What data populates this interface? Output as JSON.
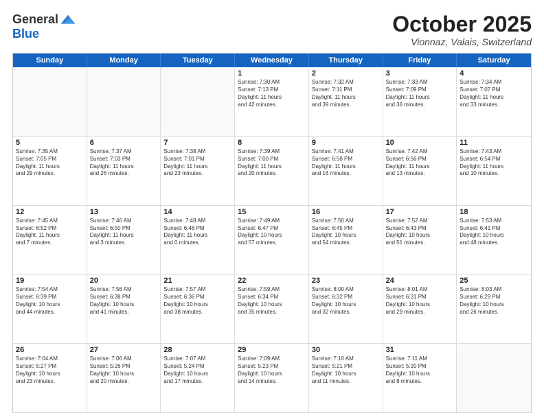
{
  "header": {
    "logo_general": "General",
    "logo_blue": "Blue",
    "month_title": "October 2025",
    "location": "Vionnaz, Valais, Switzerland"
  },
  "days_of_week": [
    "Sunday",
    "Monday",
    "Tuesday",
    "Wednesday",
    "Thursday",
    "Friday",
    "Saturday"
  ],
  "weeks": [
    [
      {
        "day": "",
        "info": "",
        "empty": true
      },
      {
        "day": "",
        "info": "",
        "empty": true
      },
      {
        "day": "",
        "info": "",
        "empty": true
      },
      {
        "day": "1",
        "info": "Sunrise: 7:30 AM\nSunset: 7:13 PM\nDaylight: 11 hours\nand 42 minutes."
      },
      {
        "day": "2",
        "info": "Sunrise: 7:32 AM\nSunset: 7:11 PM\nDaylight: 11 hours\nand 39 minutes."
      },
      {
        "day": "3",
        "info": "Sunrise: 7:33 AM\nSunset: 7:09 PM\nDaylight: 11 hours\nand 36 minutes."
      },
      {
        "day": "4",
        "info": "Sunrise: 7:34 AM\nSunset: 7:07 PM\nDaylight: 11 hours\nand 33 minutes."
      }
    ],
    [
      {
        "day": "5",
        "info": "Sunrise: 7:35 AM\nSunset: 7:05 PM\nDaylight: 11 hours\nand 29 minutes."
      },
      {
        "day": "6",
        "info": "Sunrise: 7:37 AM\nSunset: 7:03 PM\nDaylight: 11 hours\nand 26 minutes."
      },
      {
        "day": "7",
        "info": "Sunrise: 7:38 AM\nSunset: 7:01 PM\nDaylight: 11 hours\nand 23 minutes."
      },
      {
        "day": "8",
        "info": "Sunrise: 7:39 AM\nSunset: 7:00 PM\nDaylight: 11 hours\nand 20 minutes."
      },
      {
        "day": "9",
        "info": "Sunrise: 7:41 AM\nSunset: 6:58 PM\nDaylight: 11 hours\nand 16 minutes."
      },
      {
        "day": "10",
        "info": "Sunrise: 7:42 AM\nSunset: 6:56 PM\nDaylight: 11 hours\nand 13 minutes."
      },
      {
        "day": "11",
        "info": "Sunrise: 7:43 AM\nSunset: 6:54 PM\nDaylight: 11 hours\nand 10 minutes."
      }
    ],
    [
      {
        "day": "12",
        "info": "Sunrise: 7:45 AM\nSunset: 6:52 PM\nDaylight: 11 hours\nand 7 minutes."
      },
      {
        "day": "13",
        "info": "Sunrise: 7:46 AM\nSunset: 6:50 PM\nDaylight: 11 hours\nand 3 minutes."
      },
      {
        "day": "14",
        "info": "Sunrise: 7:48 AM\nSunset: 6:48 PM\nDaylight: 11 hours\nand 0 minutes."
      },
      {
        "day": "15",
        "info": "Sunrise: 7:49 AM\nSunset: 6:47 PM\nDaylight: 10 hours\nand 57 minutes."
      },
      {
        "day": "16",
        "info": "Sunrise: 7:50 AM\nSunset: 6:45 PM\nDaylight: 10 hours\nand 54 minutes."
      },
      {
        "day": "17",
        "info": "Sunrise: 7:52 AM\nSunset: 6:43 PM\nDaylight: 10 hours\nand 51 minutes."
      },
      {
        "day": "18",
        "info": "Sunrise: 7:53 AM\nSunset: 6:41 PM\nDaylight: 10 hours\nand 48 minutes."
      }
    ],
    [
      {
        "day": "19",
        "info": "Sunrise: 7:54 AM\nSunset: 6:39 PM\nDaylight: 10 hours\nand 44 minutes."
      },
      {
        "day": "20",
        "info": "Sunrise: 7:56 AM\nSunset: 6:38 PM\nDaylight: 10 hours\nand 41 minutes."
      },
      {
        "day": "21",
        "info": "Sunrise: 7:57 AM\nSunset: 6:36 PM\nDaylight: 10 hours\nand 38 minutes."
      },
      {
        "day": "22",
        "info": "Sunrise: 7:59 AM\nSunset: 6:34 PM\nDaylight: 10 hours\nand 35 minutes."
      },
      {
        "day": "23",
        "info": "Sunrise: 8:00 AM\nSunset: 6:32 PM\nDaylight: 10 hours\nand 32 minutes."
      },
      {
        "day": "24",
        "info": "Sunrise: 8:01 AM\nSunset: 6:31 PM\nDaylight: 10 hours\nand 29 minutes."
      },
      {
        "day": "25",
        "info": "Sunrise: 8:03 AM\nSunset: 6:29 PM\nDaylight: 10 hours\nand 26 minutes."
      }
    ],
    [
      {
        "day": "26",
        "info": "Sunrise: 7:04 AM\nSunset: 5:27 PM\nDaylight: 10 hours\nand 23 minutes."
      },
      {
        "day": "27",
        "info": "Sunrise: 7:06 AM\nSunset: 5:26 PM\nDaylight: 10 hours\nand 20 minutes."
      },
      {
        "day": "28",
        "info": "Sunrise: 7:07 AM\nSunset: 5:24 PM\nDaylight: 10 hours\nand 17 minutes."
      },
      {
        "day": "29",
        "info": "Sunrise: 7:09 AM\nSunset: 5:23 PM\nDaylight: 10 hours\nand 14 minutes."
      },
      {
        "day": "30",
        "info": "Sunrise: 7:10 AM\nSunset: 5:21 PM\nDaylight: 10 hours\nand 11 minutes."
      },
      {
        "day": "31",
        "info": "Sunrise: 7:11 AM\nSunset: 5:20 PM\nDaylight: 10 hours\nand 8 minutes."
      },
      {
        "day": "",
        "info": "",
        "empty": true
      }
    ]
  ]
}
